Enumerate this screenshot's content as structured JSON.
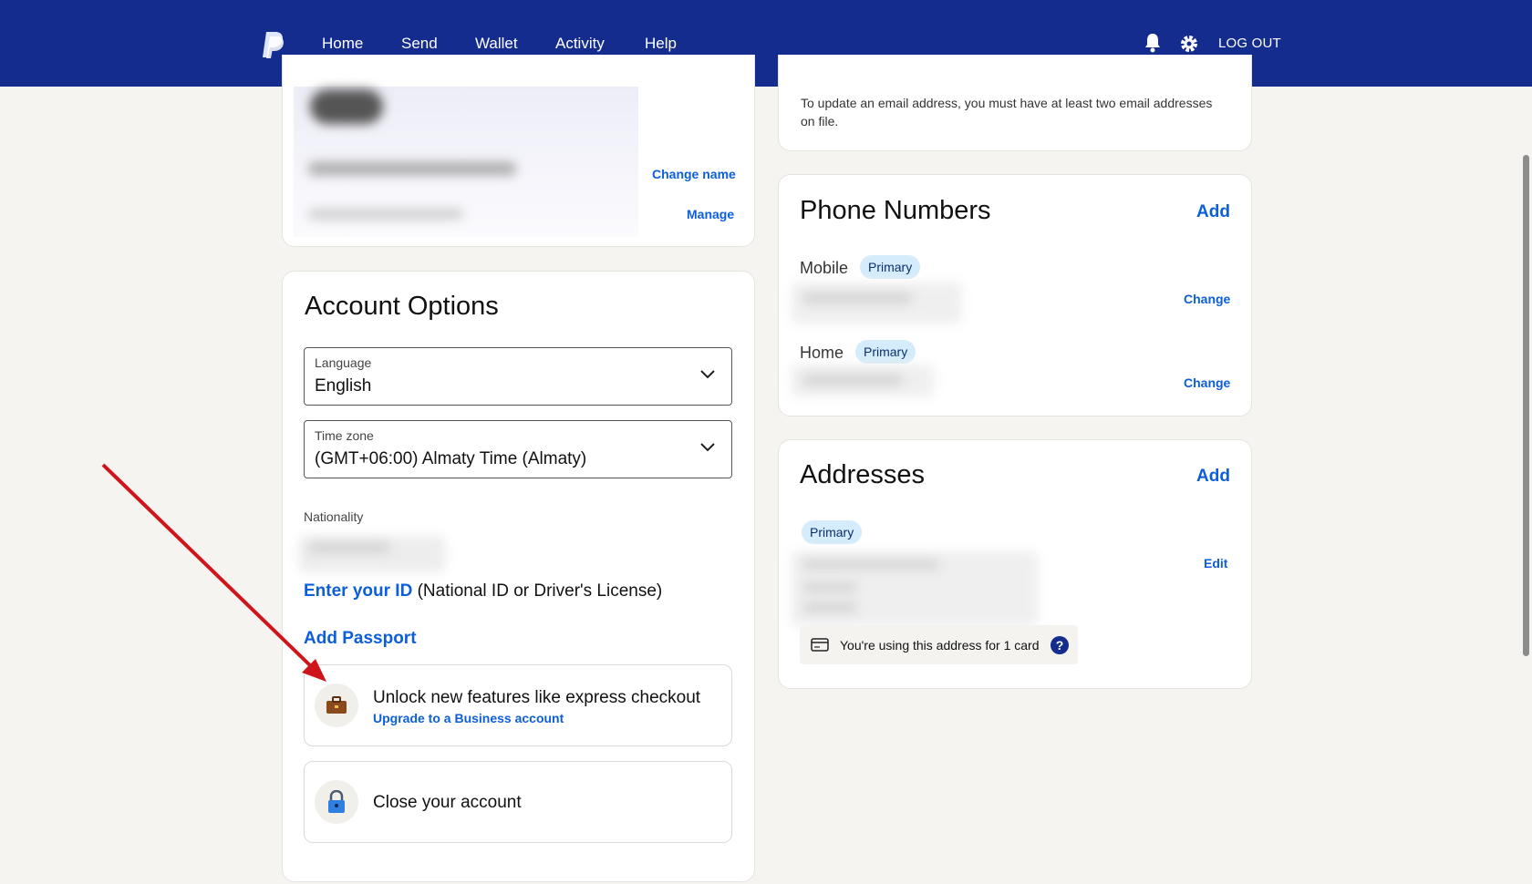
{
  "nav": {
    "items": [
      "Home",
      "Send",
      "Wallet",
      "Activity",
      "Help"
    ],
    "logout": "LOG OUT",
    "icons": [
      "bell-icon",
      "gear-icon"
    ]
  },
  "profile": {
    "change_name": "Change name",
    "manage": "Manage"
  },
  "email": {
    "note": "To update an email address, you must have at least two email addresses on file."
  },
  "account_options": {
    "title": "Account Options",
    "language": {
      "label": "Language",
      "value": "English"
    },
    "timezone": {
      "label": "Time zone",
      "value": "(GMT+06:00) Almaty Time (Almaty)"
    },
    "nationality_label": "Nationality",
    "enter_id_link": "Enter your ID",
    "enter_id_suffix": "(National ID or Driver's License)",
    "add_passport": "Add Passport",
    "upgrade": {
      "title": "Unlock new features like express checkout",
      "link": "Upgrade to a Business account"
    },
    "close": {
      "title": "Close your account"
    }
  },
  "phones": {
    "title": "Phone Numbers",
    "add": "Add",
    "items": [
      {
        "type": "Mobile",
        "badge": "Primary",
        "action": "Change"
      },
      {
        "type": "Home",
        "badge": "Primary",
        "action": "Change"
      }
    ]
  },
  "addresses": {
    "title": "Addresses",
    "add": "Add",
    "badge": "Primary",
    "edit": "Edit",
    "card_note": "You're using this address for 1 card"
  },
  "colors": {
    "brand": "#142c8e",
    "link": "#0d5ed9",
    "badge": "#d4ecfb",
    "annotation_arrow": "#d0141c"
  }
}
